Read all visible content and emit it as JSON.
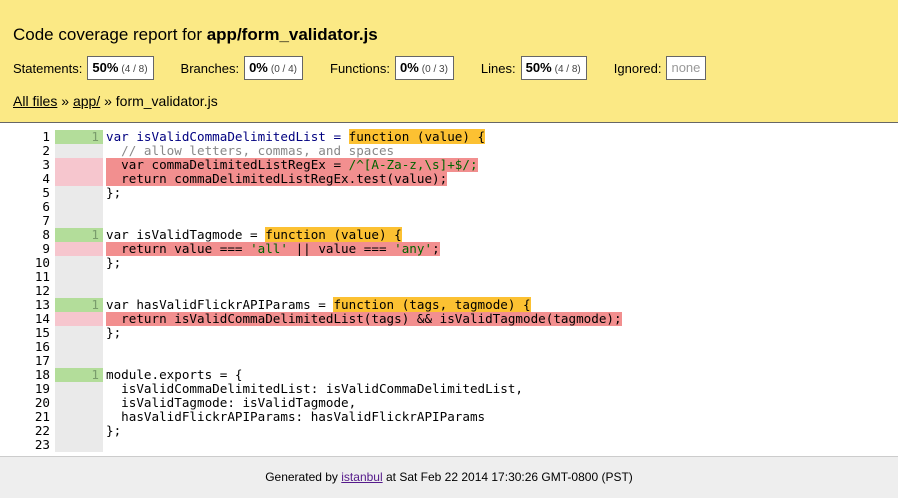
{
  "header": {
    "title_prefix": "Code coverage report for ",
    "title_file": "app/form_validator.js",
    "metrics": [
      {
        "label": "Statements:",
        "pct": "50%",
        "frac": "(4 / 8)"
      },
      {
        "label": "Branches:",
        "pct": "0%",
        "frac": "(0 / 4)"
      },
      {
        "label": "Functions:",
        "pct": "0%",
        "frac": "(0 / 3)"
      },
      {
        "label": "Lines:",
        "pct": "50%",
        "frac": "(4 / 8)"
      },
      {
        "label": "Ignored:",
        "value": "none"
      }
    ],
    "breadcrumb": {
      "all_files": "All files",
      "sep1": " » ",
      "dir": "app/",
      "sep2": " » ",
      "file": "form_validator.js"
    }
  },
  "lines": [
    {
      "n": "1",
      "count": "1",
      "state": "hit"
    },
    {
      "n": "2",
      "count": "",
      "state": "none"
    },
    {
      "n": "3",
      "count": "",
      "state": "miss"
    },
    {
      "n": "4",
      "count": "",
      "state": "miss"
    },
    {
      "n": "5",
      "count": "",
      "state": "none"
    },
    {
      "n": "6",
      "count": "",
      "state": "none"
    },
    {
      "n": "7",
      "count": "",
      "state": "none"
    },
    {
      "n": "8",
      "count": "1",
      "state": "hit"
    },
    {
      "n": "9",
      "count": "",
      "state": "miss"
    },
    {
      "n": "10",
      "count": "",
      "state": "none"
    },
    {
      "n": "11",
      "count": "",
      "state": "none"
    },
    {
      "n": "12",
      "count": "",
      "state": "none"
    },
    {
      "n": "13",
      "count": "1",
      "state": "hit"
    },
    {
      "n": "14",
      "count": "",
      "state": "miss"
    },
    {
      "n": "15",
      "count": "",
      "state": "none"
    },
    {
      "n": "16",
      "count": "",
      "state": "none"
    },
    {
      "n": "17",
      "count": "",
      "state": "none"
    },
    {
      "n": "18",
      "count": "1",
      "state": "hit"
    },
    {
      "n": "19",
      "count": "",
      "state": "none"
    },
    {
      "n": "20",
      "count": "",
      "state": "none"
    },
    {
      "n": "21",
      "count": "",
      "state": "none"
    },
    {
      "n": "22",
      "count": "",
      "state": "none"
    },
    {
      "n": "23",
      "count": "",
      "state": "none"
    }
  ],
  "code": {
    "l1a": "var isValidCommaDelimitedList = ",
    "l1b": "function (value) {",
    "l2": "  // allow letters, commas, and spaces",
    "l3a": "  var commaDelimitedListRegEx = ",
    "l3b": "/^[A-Za-z,\\s]+$/;",
    "l4": "  return commaDelimitedListRegEx.test(value);",
    "l5": "};",
    "l8a": "var isValidTagmode = ",
    "l8b": "function (value) {",
    "l9a": "  return value === ",
    "l9b": "'all'",
    "l9c": " || value === ",
    "l9d": "'any'",
    "l9e": ";",
    "l10": "};",
    "l13a": "var hasValidFlickrAPIParams = ",
    "l13b": "function (tags, tagmode) {",
    "l14": "  return isValidCommaDelimitedList(tags) && isValidTagmode(tagmode);",
    "l15": "};",
    "l18": "module.exports = {",
    "l19": "  isValidCommaDelimitedList: isValidCommaDelimitedList,",
    "l20": "  isValidTagmode: isValidTagmode,",
    "l21": "  hasValidFlickrAPIParams: hasValidFlickrAPIParams",
    "l22": "};"
  },
  "footer": {
    "prefix": "Generated by ",
    "link": "istanbul",
    "suffix": " at Sat Feb 22 2014 17:30:26 GMT-0800 (PST)"
  }
}
